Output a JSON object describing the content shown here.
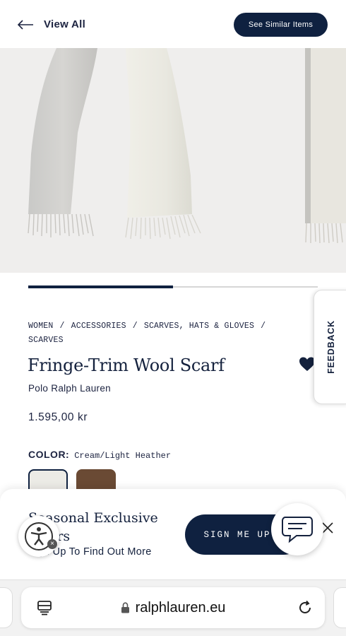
{
  "header": {
    "back_label": "View All",
    "similar_label": "See Similar Items"
  },
  "gallery": {
    "slide_progress": 0.5
  },
  "product": {
    "breadcrumb": [
      "WOMEN",
      "ACCESSORIES",
      "SCARVES, HATS & GLOVES",
      "SCARVES"
    ],
    "breadcrumb_separator": "/",
    "title": "Fringe-Trim Wool Scarf",
    "brand": "Polo Ralph Lauren",
    "price": "1.595,00 kr",
    "color_label": "COLOR:",
    "color_value": "Cream/Light Heather",
    "swatches": [
      {
        "name": "Cream/Light Heather",
        "color": "#ecebe6",
        "selected": true
      },
      {
        "name": "Brown",
        "color": "#6a4a34",
        "selected": false
      }
    ]
  },
  "feedback": {
    "label": "FEEDBACK"
  },
  "promo": {
    "title": "Seasonal Exclusive Offers",
    "subtitle": "Sign Up To Find Out More",
    "signup_label": "SIGN ME UP"
  },
  "browser": {
    "url": "ralphlauren.eu"
  },
  "colors": {
    "navy": "#0f2140",
    "gallery_bg": "#efeeed"
  }
}
